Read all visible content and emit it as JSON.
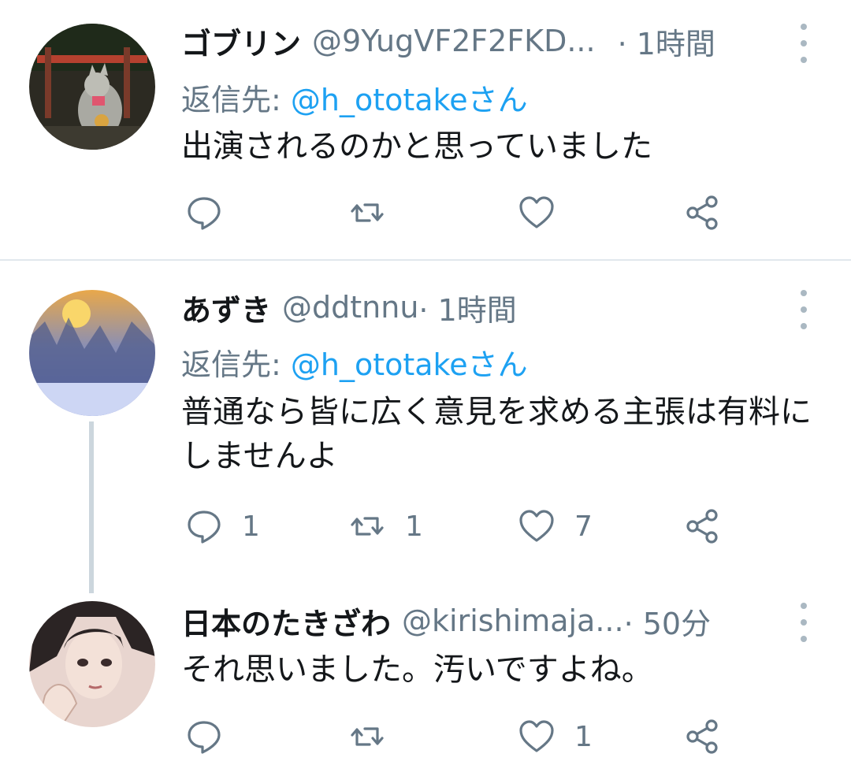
{
  "tweets": [
    {
      "name": "ゴブリン",
      "handle": "@9YugVF2F2FKD...",
      "time": "· 1時間",
      "reply_label": "返信先: ",
      "reply_target": "@h_ototakeさん",
      "text": "出演されるのかと思っていました",
      "replies": "",
      "retweets": "",
      "likes": ""
    },
    {
      "name": "あずき",
      "handle": "@ddtnnu",
      "time": " · 1時間",
      "reply_label": "返信先: ",
      "reply_target": "@h_ototakeさん",
      "text": "普通なら皆に広く意見を求める主張は有料にしませんよ",
      "replies": "1",
      "retweets": "1",
      "likes": "7"
    },
    {
      "name": "日本のたきざわ",
      "handle": "@kirishimaja...",
      "time": " · 50分",
      "text": "それ思いました。汚いですよね。",
      "replies": "",
      "retweets": "",
      "likes": "1"
    }
  ],
  "colors": {
    "accent": "#1da1f2",
    "secondary_text": "#657786",
    "divider": "#e1e8ed",
    "thread_line": "#ccd6dd"
  },
  "icons": {
    "reply": "speech-bubble-icon",
    "retweet": "retweet-icon",
    "like": "heart-icon",
    "share": "share-icon",
    "more": "vertical-dots-icon"
  }
}
